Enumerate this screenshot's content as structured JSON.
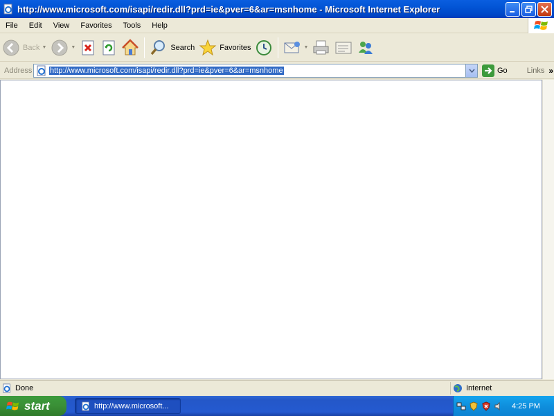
{
  "window": {
    "title": "http://www.microsoft.com/isapi/redir.dll?prd=ie&pver=6&ar=msnhome - Microsoft Internet Explorer"
  },
  "menu": {
    "items": [
      "File",
      "Edit",
      "View",
      "Favorites",
      "Tools",
      "Help"
    ]
  },
  "toolbar": {
    "back_label": "Back",
    "search_label": "Search",
    "favorites_label": "Favorites"
  },
  "address": {
    "label": "Address",
    "url": "http://www.microsoft.com/isapi/redir.dll?prd=ie&pver=6&ar=msnhome",
    "go_label": "Go",
    "links_label": "Links"
  },
  "status": {
    "text": "Done",
    "zone": "Internet"
  },
  "taskbar": {
    "start_label": "start",
    "task_label": "http://www.microsoft...",
    "clock": "4:25 PM"
  },
  "colors": {
    "titlebar": "#0254d5",
    "selection": "#316ac5",
    "taskbar": "#245ad0",
    "start": "#3a8f36"
  }
}
